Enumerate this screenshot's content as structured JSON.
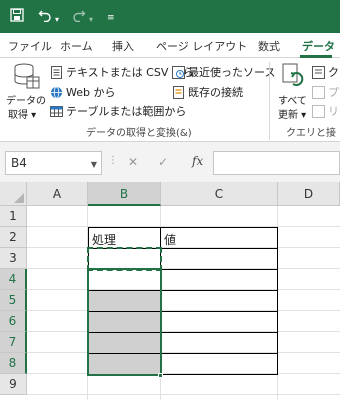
{
  "qat": {
    "save_icon": "save-icon",
    "undo_icon": "undo-icon",
    "redo_icon": "redo-icon",
    "customize_icon": "customize-qat-icon"
  },
  "tabs": [
    "ファイル",
    "ホーム",
    "挿入",
    "ページ レイアウト",
    "数式",
    "データ"
  ],
  "ribbon": {
    "get_data_label": "データの\n取得 ▾",
    "get_data_line1": "データの",
    "get_data_line2": "取得 ▾",
    "text_csv": "テキストまたは CSV から",
    "web": "Web から",
    "table_range": "テーブルまたは範囲から",
    "recent_sources": "最近使ったソース",
    "existing_connections": "既存の接続",
    "group_label": "データの取得と変換(&)",
    "refresh_all_line1": "すべて",
    "refresh_all_line2": "更新 ▾",
    "queries_label": "クエリと接",
    "right_item1": "ク",
    "right_item2": "プ",
    "right_item3": "リ"
  },
  "formula_bar": {
    "name_box": "B4",
    "fx": "fx",
    "formula": ""
  },
  "grid": {
    "columns": [
      "A",
      "B",
      "C",
      "D"
    ],
    "rows": [
      "1",
      "2",
      "3",
      "4",
      "5",
      "6",
      "7",
      "8",
      "9"
    ],
    "cells": {
      "B2": "処理",
      "C2": "値"
    }
  },
  "colors": {
    "accent": "#217346",
    "fill_gray": "#d0d0d0"
  }
}
